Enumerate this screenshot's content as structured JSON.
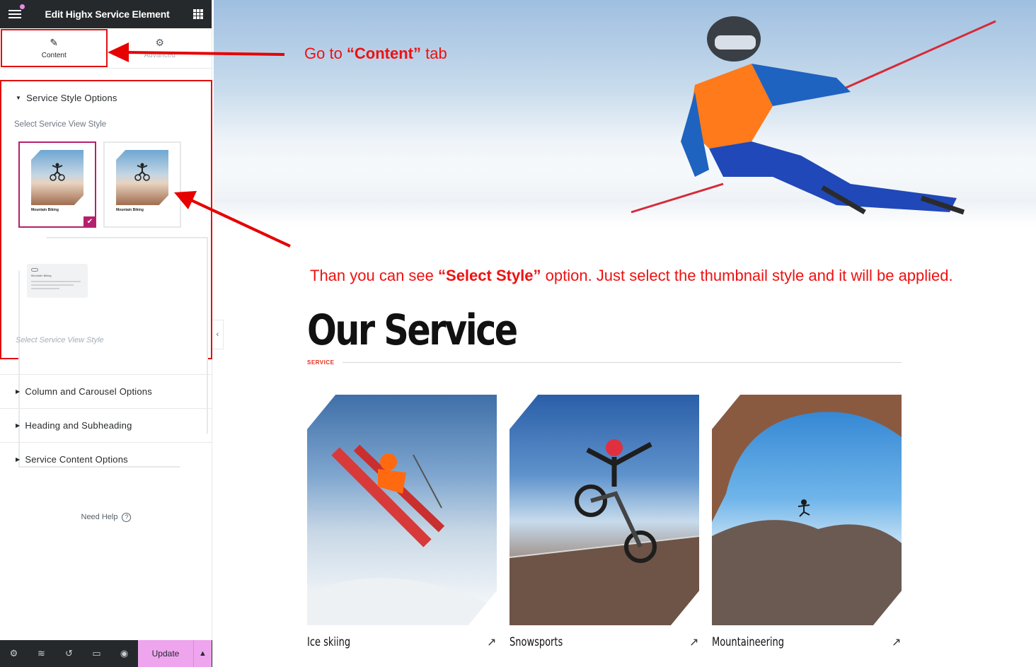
{
  "panel": {
    "title": "Edit Highx Service Element",
    "tabs": [
      {
        "label": "Content",
        "icon": "pencil-icon"
      },
      {
        "label": "Advanced",
        "icon": "gear-icon"
      }
    ],
    "open_section": {
      "title": "Service Style Options",
      "field_label": "Select Service View Style",
      "help": "Select Service View Style",
      "thumbnails": [
        {
          "caption": "Mountain Biking",
          "selected": true
        },
        {
          "caption": "Mountain Biking",
          "selected": false
        },
        {
          "caption": "Mountain Biking",
          "selected": false
        }
      ]
    },
    "sections": [
      "Column and Carousel Options",
      "Heading and Subheading",
      "Service Content Options"
    ],
    "need_help": "Need Help",
    "update_label": "Update"
  },
  "annotations": {
    "content_tab": {
      "before": "Go  to ",
      "strong": "“Content”",
      "after": " tab"
    },
    "select_style": {
      "before": "Than you can see ",
      "strong": "“Select Style”",
      "after": " option. Just select the thumbnail style and it will be applied."
    }
  },
  "preview": {
    "heading": "Our Service",
    "subheading": "SERVICE",
    "services": [
      {
        "title": "Ice skiing"
      },
      {
        "title": "Snowsports"
      },
      {
        "title": "Mountaineering"
      }
    ]
  },
  "colors": {
    "accent": "#b5206e",
    "annotation": "#ee1111",
    "update_button": "#eea5ee"
  }
}
